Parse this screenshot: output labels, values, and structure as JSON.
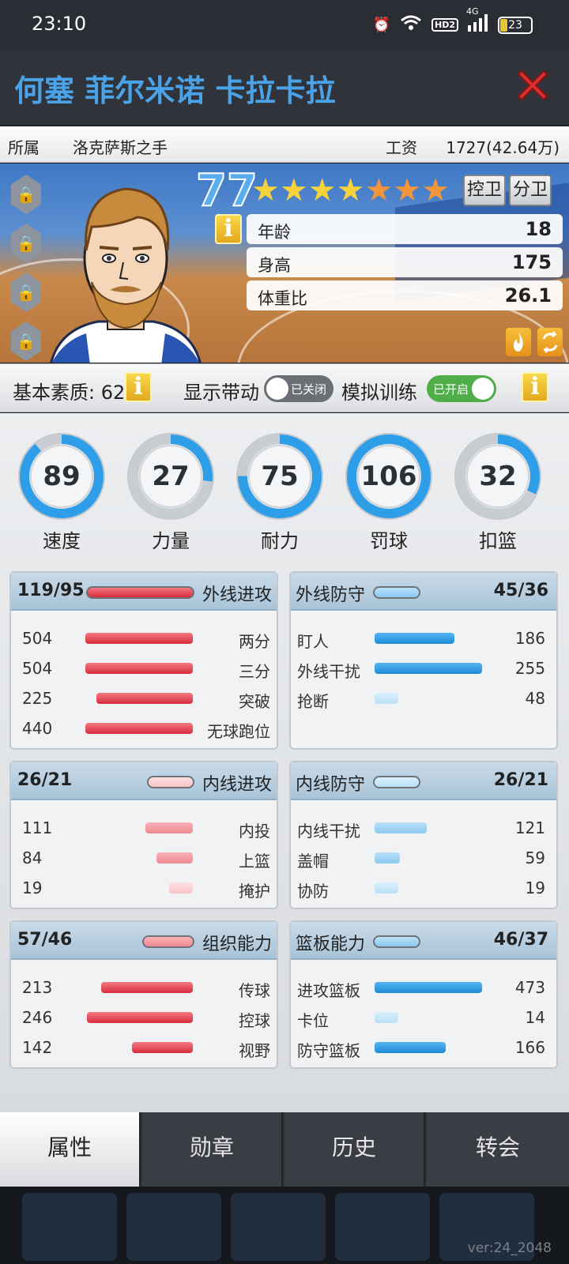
{
  "status_bar": {
    "time": "23:10",
    "network": "4G",
    "hd_badge": "HD2",
    "battery": "23"
  },
  "player": {
    "name": "何塞 菲尔米诺 卡拉卡拉",
    "club_label": "所属",
    "club": "洛克萨斯之手",
    "salary_label": "工资",
    "salary": "1727(42.64万)",
    "overall": "77",
    "stars_gold": 4,
    "stars_orange": 3,
    "positions": [
      "控卫",
      "分卫"
    ],
    "age_label": "年龄",
    "age": "18",
    "height_label": "身高",
    "height": "175",
    "weight_label": "体重比",
    "weight": "26.1"
  },
  "quality": {
    "label": "基本素质: 62",
    "show_drive_label": "显示带动",
    "show_drive_state": "已关闭",
    "sim_train_label": "模拟训练",
    "sim_train_state": "已开启"
  },
  "gauges": [
    {
      "label": "速度",
      "value": "89",
      "fill": 0.89
    },
    {
      "label": "力量",
      "value": "27",
      "fill": 0.27
    },
    {
      "label": "耐力",
      "value": "75",
      "fill": 0.75
    },
    {
      "label": "罚球",
      "value": "106",
      "fill": 1.0
    },
    {
      "label": "扣篮",
      "value": "32",
      "fill": 0.32
    }
  ],
  "panels": {
    "outside_offense": {
      "title": "外线进攻",
      "score": "119/95",
      "rows": [
        {
          "value": "504",
          "label": "两分"
        },
        {
          "value": "504",
          "label": "三分"
        },
        {
          "value": "225",
          "label": "突破"
        },
        {
          "value": "440",
          "label": "无球跑位"
        }
      ]
    },
    "outside_defense": {
      "title": "外线防守",
      "score": "45/36",
      "rows": [
        {
          "value": "186",
          "label": "盯人"
        },
        {
          "value": "255",
          "label": "外线干扰"
        },
        {
          "value": "48",
          "label": "抢断"
        }
      ]
    },
    "inside_offense": {
      "title": "内线进攻",
      "score": "26/21",
      "rows": [
        {
          "value": "111",
          "label": "内投"
        },
        {
          "value": "84",
          "label": "上篮"
        },
        {
          "value": "19",
          "label": "掩护"
        }
      ]
    },
    "inside_defense": {
      "title": "内线防守",
      "score": "26/21",
      "rows": [
        {
          "value": "121",
          "label": "内线干扰"
        },
        {
          "value": "59",
          "label": "盖帽"
        },
        {
          "value": "19",
          "label": "协防"
        }
      ]
    },
    "playmaking": {
      "title": "组织能力",
      "score": "57/46",
      "rows": [
        {
          "value": "213",
          "label": "传球"
        },
        {
          "value": "246",
          "label": "控球"
        },
        {
          "value": "142",
          "label": "视野"
        }
      ]
    },
    "rebounding": {
      "title": "篮板能力",
      "score": "46/37",
      "rows": [
        {
          "value": "473",
          "label": "进攻篮板"
        },
        {
          "value": "14",
          "label": "卡位"
        },
        {
          "value": "166",
          "label": "防守篮板"
        }
      ]
    }
  },
  "tabs": [
    "属性",
    "勋章",
    "历史",
    "转会"
  ],
  "active_tab": "属性",
  "version": "ver:24_2048",
  "colors": {
    "title_blue": "#4aa3e8",
    "bar_red": "#d62c3b",
    "bar_blue": "#1d8ad8",
    "toggle_on": "#5cb85c"
  }
}
